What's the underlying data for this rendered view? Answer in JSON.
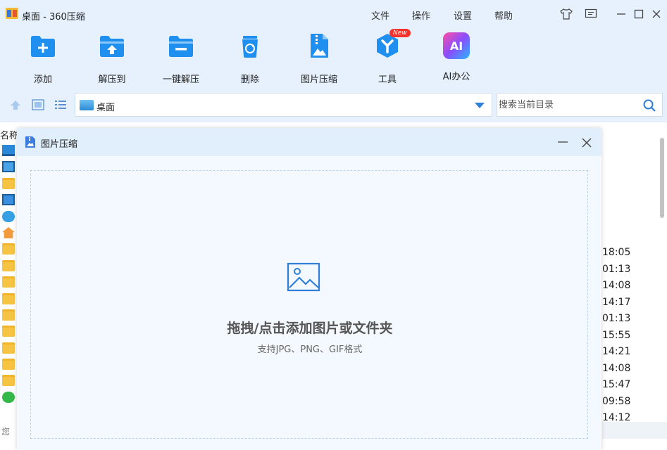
{
  "window": {
    "title": "桌面 - 360压缩"
  },
  "menu": {
    "file": "文件",
    "operate": "操作",
    "settings": "设置",
    "help": "帮助"
  },
  "toolbar": {
    "items": [
      {
        "label": "添加",
        "icon": "add-icon"
      },
      {
        "label": "解压到",
        "icon": "extract-to-icon"
      },
      {
        "label": "一键解压",
        "icon": "one-click-extract-icon"
      },
      {
        "label": "删除",
        "icon": "delete-icon"
      },
      {
        "label": "图片压缩",
        "icon": "image-compress-icon"
      },
      {
        "label": "工具",
        "icon": "tools-icon"
      },
      {
        "label": "AI办公",
        "icon": "ai-office-icon"
      }
    ],
    "tools_badge": "New",
    "ai_icon_text": "AI"
  },
  "address": {
    "path": "桌面",
    "search_placeholder": "搜索当前目录"
  },
  "filelist": {
    "column_name": "名称",
    "times": [
      "18:05",
      "01:13",
      "14:08",
      "14:17",
      "01:13",
      "15:55",
      "14:21",
      "14:08",
      "15:47",
      "09:58",
      "14:12"
    ],
    "status_fragment": "您"
  },
  "dialog": {
    "title": "图片压缩",
    "drop_title": "拖拽/点击添加图片或文件夹",
    "drop_subtitle": "支持JPG、PNG、GIF格式"
  },
  "colors": {
    "accent": "#1f8ff0",
    "chrome_bg": "#e6f1fd",
    "dialog_bg": "#f4f9ff",
    "badge": "#f5312b"
  }
}
